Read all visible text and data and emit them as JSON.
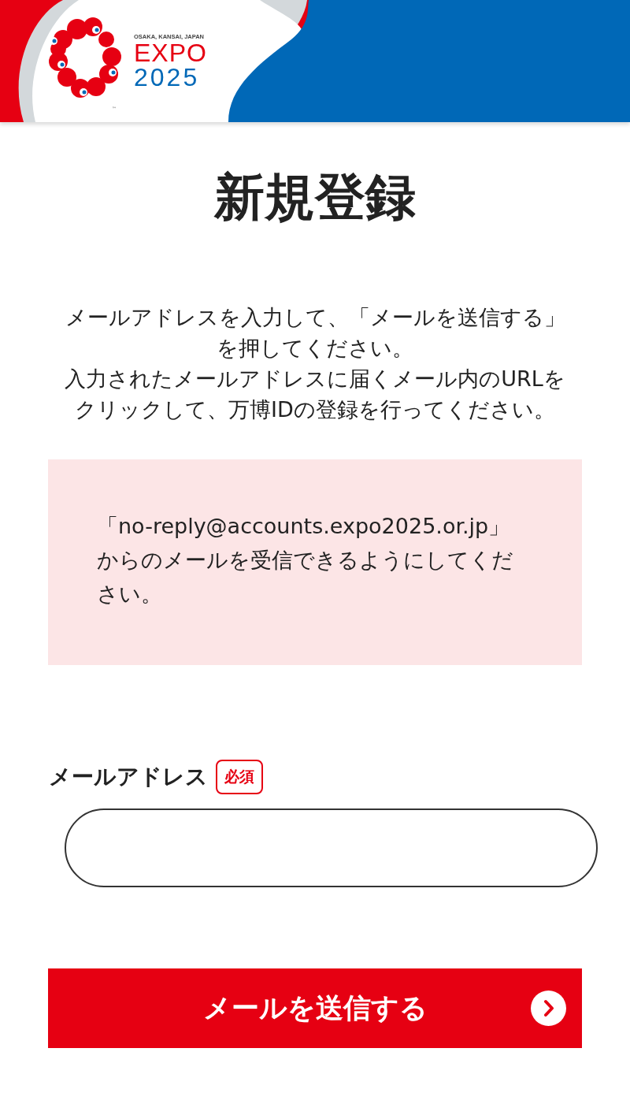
{
  "header": {
    "logo_caption": "OSAKA, KANSAI, JAPAN",
    "logo_word": "EXPO",
    "logo_year": "2025",
    "logo_tm": "™"
  },
  "title": "新規登録",
  "intro": [
    "メールアドレスを入力して、「メールを送信する」を押してください。",
    "入力されたメールアドレスに届くメール内のURLをクリックして、万博IDの登録を行ってください。"
  ],
  "notice": "「no-reply@accounts.expo2025.or.jp」からのメールを受信できるようにしてください。",
  "form": {
    "label": "メールアドレス",
    "required_badge": "必須"
  },
  "submit_button": "メールを送信する"
}
